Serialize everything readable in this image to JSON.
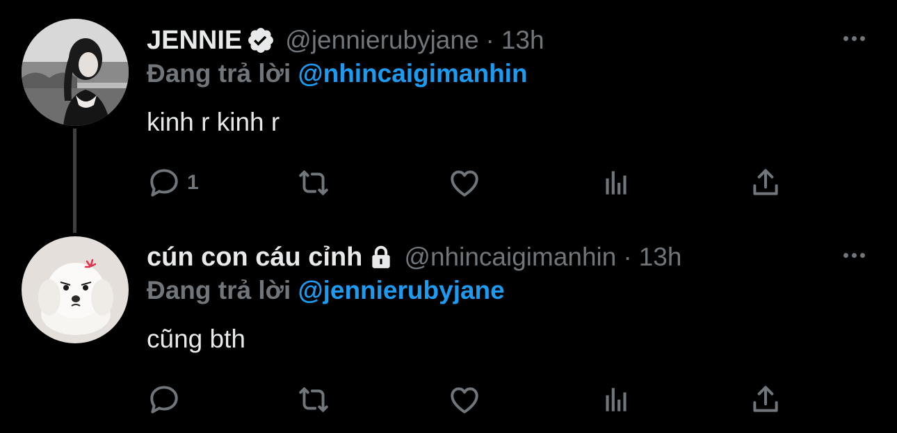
{
  "tweets": [
    {
      "display_name": "JENNIE",
      "badge": "verified-icon",
      "handle": "@jennierubyjane",
      "separator": "·",
      "time": "13h",
      "reply_prefix": "Đang trả lời",
      "reply_to": "@nhincaigimanhin",
      "text": "kinh r kinh r",
      "reply_count": "1"
    },
    {
      "display_name": "cún con cáu cỉnh",
      "badge": "lock-icon",
      "handle": "@nhincaigimanhin",
      "separator": "·",
      "time": "13h",
      "reply_prefix": "Đang trả lời",
      "reply_to": "@jennierubyjane",
      "text": "cũng bth",
      "reply_count": ""
    }
  ],
  "colors": {
    "background": "#000000",
    "text": "#e7e9ea",
    "muted": "#71767b",
    "accent": "#1d9bf0",
    "thread_line": "#3e4144"
  }
}
